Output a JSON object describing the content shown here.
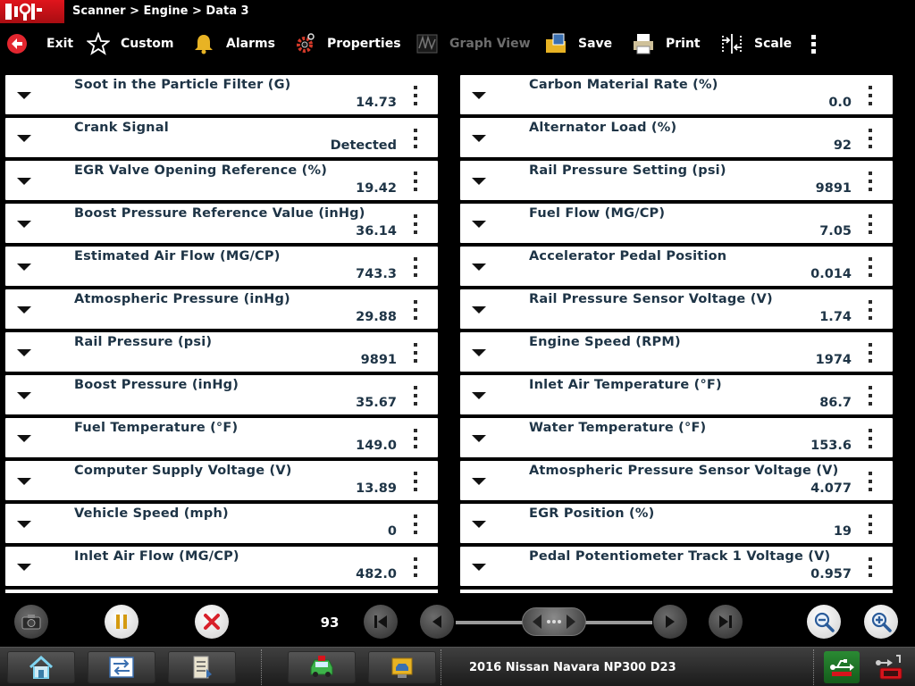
{
  "header": {
    "breadcrumb": "Scanner > Engine > Data 3"
  },
  "toolbar": {
    "exit": "Exit",
    "custom": "Custom",
    "alarms": "Alarms",
    "properties": "Properties",
    "graph_view": "Graph View",
    "save": "Save",
    "print": "Print",
    "scale": "Scale"
  },
  "data_left": [
    {
      "name": "Soot in the Particle Filter (G)",
      "value": "14.73"
    },
    {
      "name": "Crank Signal",
      "value": "Detected"
    },
    {
      "name": "EGR Valve Opening Reference (%)",
      "value": "19.42"
    },
    {
      "name": "Boost Pressure Reference Value (inHg)",
      "value": "36.14"
    },
    {
      "name": "Estimated Air Flow (MG/CP)",
      "value": "743.3"
    },
    {
      "name": "Atmospheric Pressure (inHg)",
      "value": "29.88"
    },
    {
      "name": "Rail Pressure (psi)",
      "value": "9891"
    },
    {
      "name": "Boost Pressure (inHg)",
      "value": "35.67"
    },
    {
      "name": "Fuel Temperature (°F)",
      "value": "149.0"
    },
    {
      "name": "Computer Supply Voltage (V)",
      "value": "13.89"
    },
    {
      "name": "Vehicle Speed (mph)",
      "value": "0"
    },
    {
      "name": "Inlet Air Flow (MG/CP)",
      "value": "482.0"
    }
  ],
  "data_right": [
    {
      "name": "Carbon Material Rate (%)",
      "value": "0.0"
    },
    {
      "name": "Alternator Load (%)",
      "value": "92"
    },
    {
      "name": "Rail Pressure Setting (psi)",
      "value": "9891"
    },
    {
      "name": "Fuel Flow (MG/CP)",
      "value": "7.05"
    },
    {
      "name": "Accelerator Pedal Position",
      "value": "0.014"
    },
    {
      "name": "Rail Pressure Sensor Voltage (V)",
      "value": "1.74"
    },
    {
      "name": "Engine Speed (RPM)",
      "value": "1974"
    },
    {
      "name": "Inlet Air Temperature (°F)",
      "value": "86.7"
    },
    {
      "name": "Water Temperature (°F)",
      "value": "153.6"
    },
    {
      "name": "Atmospheric Pressure Sensor Voltage (V)",
      "value": "4.077"
    },
    {
      "name": "EGR Position (%)",
      "value": "19"
    },
    {
      "name": "Pedal Potentiometer Track 1 Voltage (V)",
      "value": "0.957"
    }
  ],
  "controls": {
    "frame_count": "93"
  },
  "taskbar": {
    "vehicle": "2016 Nissan Navara NP300 D23"
  },
  "colors": {
    "brand_red": "#d7141c",
    "text_dark": "#1e3446",
    "cancel_red": "#d8202a"
  }
}
